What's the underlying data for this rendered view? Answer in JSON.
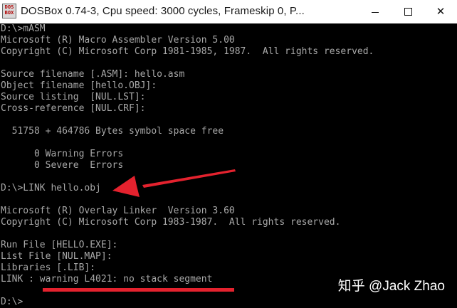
{
  "window": {
    "title": "DOSBox 0.74-3, Cpu speed:     3000 cycles, Frameskip  0, P...",
    "icon": {
      "name": "dosbox-app-icon",
      "line1": "DOS",
      "line2": "BOX"
    },
    "controls": {
      "minimize": "minimize-icon",
      "maximize": "maximize-icon",
      "close": "close-icon",
      "close_glyph": "✕"
    }
  },
  "console": {
    "lines": [
      "D:\\>mASM",
      "Microsoft (R) Macro Assembler Version 5.00",
      "Copyright (C) Microsoft Corp 1981-1985, 1987.  All rights reserved.",
      "",
      "Source filename [.ASM]: hello.asm",
      "Object filename [hello.OBJ]:",
      "Source listing  [NUL.LST]:",
      "Cross-reference [NUL.CRF]:",
      "",
      "  51758 + 464786 Bytes symbol space free",
      "",
      "      0 Warning Errors",
      "      0 Severe  Errors",
      "",
      "D:\\>LINK hello.obj",
      "",
      "Microsoft (R) Overlay Linker  Version 3.60",
      "Copyright (C) Microsoft Corp 1983-1987.  All rights reserved.",
      "",
      "Run File [HELLO.EXE]:",
      "List File [NUL.MAP]:",
      "Libraries [.LIB]:",
      "LINK : warning L4021: no stack segment",
      "",
      "D:\\>"
    ]
  },
  "annotations": {
    "arrow_color": "#e4222e",
    "underline_color": "#e4222e"
  },
  "watermark": "知乎 @Jack Zhao"
}
